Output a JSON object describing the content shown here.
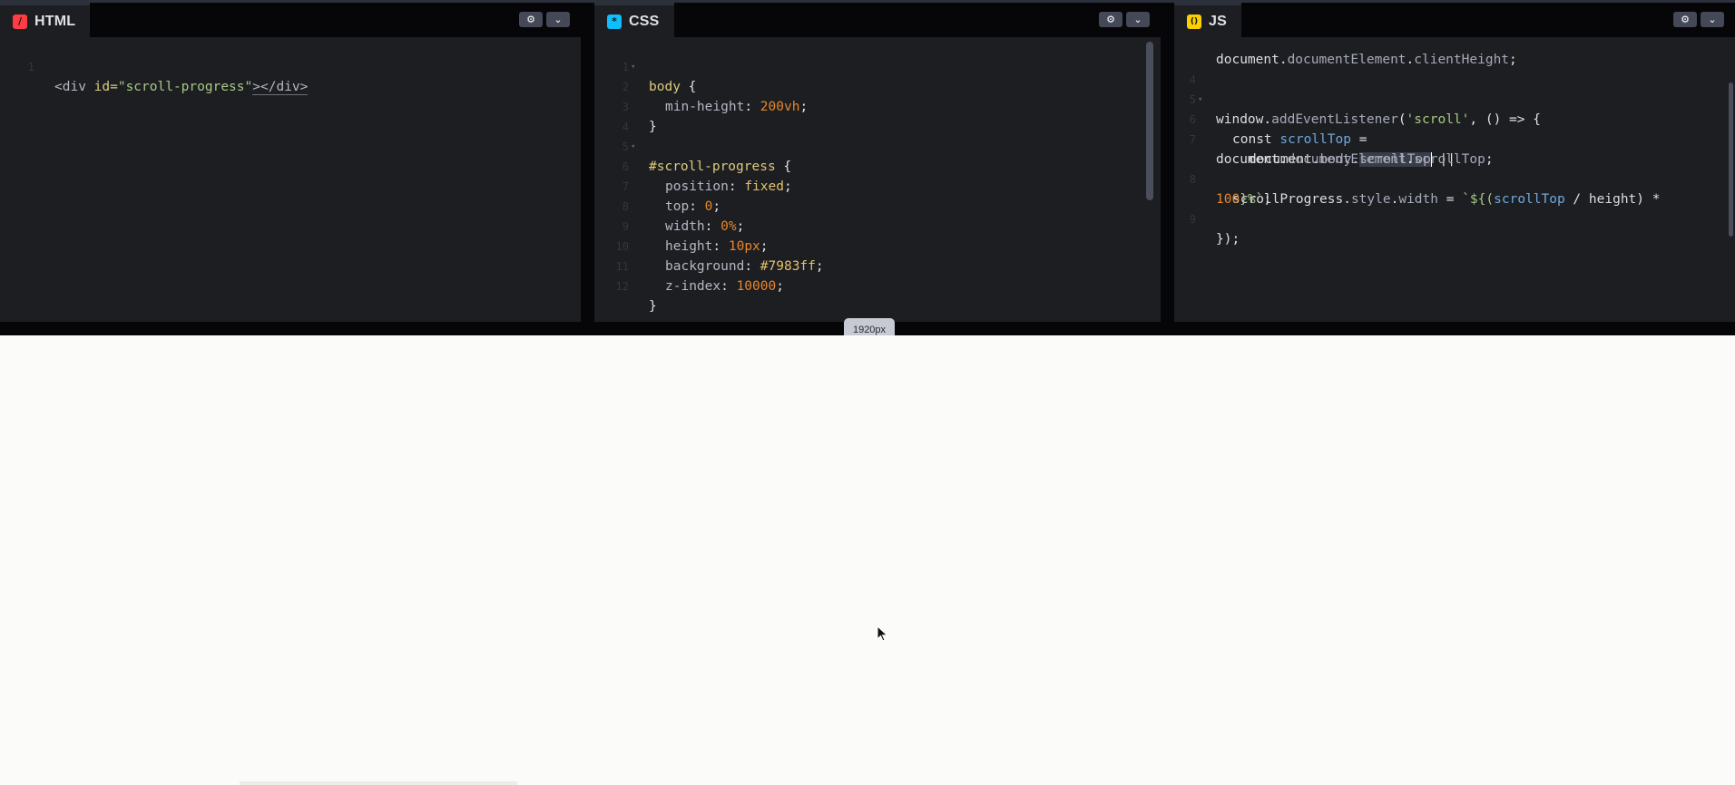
{
  "panels": {
    "html": {
      "label": "HTML",
      "icon": "/",
      "icon_color": "#ff3c41",
      "icon_name": "html-slash-icon"
    },
    "css": {
      "label": "CSS",
      "icon": "*",
      "icon_color": "#0ebeff",
      "icon_name": "css-asterisk-icon"
    },
    "js": {
      "label": "JS",
      "icon": "()",
      "icon_color": "#fcd000",
      "icon_name": "js-parens-icon"
    }
  },
  "header_buttons": {
    "settings_icon": "⚙",
    "collapse_icon": "⌄"
  },
  "html_code": {
    "line_numbers": [
      "1"
    ],
    "line1": {
      "open": "<div",
      "attr": " id=",
      "value": "\"scroll-progress\"",
      "close": "></div>"
    }
  },
  "css_code": {
    "line_numbers": [
      "1",
      "2",
      "3",
      "4",
      "5",
      "6",
      "7",
      "8",
      "9",
      "10",
      "11",
      "12"
    ],
    "l1": {
      "sel": "body",
      "brace": " {"
    },
    "l2": {
      "prop": "min-height",
      "colon": ": ",
      "val": "200vh",
      "end": ";"
    },
    "l3": "}",
    "l5": {
      "sel": "#scroll-progress",
      "brace": " {"
    },
    "l6": {
      "prop": "position",
      "colon": ": ",
      "val": "fixed",
      "end": ";"
    },
    "l7": {
      "prop": "top",
      "colon": ": ",
      "val": "0",
      "end": ";"
    },
    "l8": {
      "prop": "width",
      "colon": ": ",
      "val": "0%",
      "end": ";"
    },
    "l9": {
      "prop": "height",
      "colon": ": ",
      "val": "10px",
      "end": ";"
    },
    "l10": {
      "prop": "background",
      "colon": ": ",
      "val": "#7983ff",
      "end": ";"
    },
    "l11": {
      "prop": "z-index",
      "colon": ": ",
      "val": "10000",
      "end": ";"
    },
    "l12": "}"
  },
  "js_code": {
    "line_numbers": [
      "4",
      "5",
      "6",
      "7",
      "8",
      "9"
    ],
    "l3b": {
      "a": "document",
      "b": ".",
      "c": "documentElement",
      "d": ".",
      "e": "clientHeight",
      "f": ";"
    },
    "l5": {
      "a": "window",
      "b": ".",
      "c": "addEventListener",
      "d": "(",
      "e": "'scroll'",
      "f": ", () => {"
    },
    "l6": {
      "a": "const ",
      "b": "scrollTop",
      "c": " ="
    },
    "l7": {
      "a": "document",
      "b": ".",
      "c": "body",
      "d": ".",
      "e": "scrollTop",
      "f": " ||"
    },
    "l7b": {
      "a": "document",
      "b": ".",
      "c": "documentElement",
      "d": ".",
      "e": "scrollTop",
      "f": ";"
    },
    "l8": {
      "a": "scrollProgress",
      "b": ".",
      "c": "style",
      "d": ".",
      "e": "width",
      "f": " = ",
      "g": "`${(",
      "h": "scrollTop",
      "i": " / ",
      "j": "height",
      "k": ") *"
    },
    "l8b": {
      "a": "100",
      "b": "}%`",
      "c": ";"
    },
    "l9": "});"
  },
  "resize_handle": {
    "label": "1920px"
  }
}
